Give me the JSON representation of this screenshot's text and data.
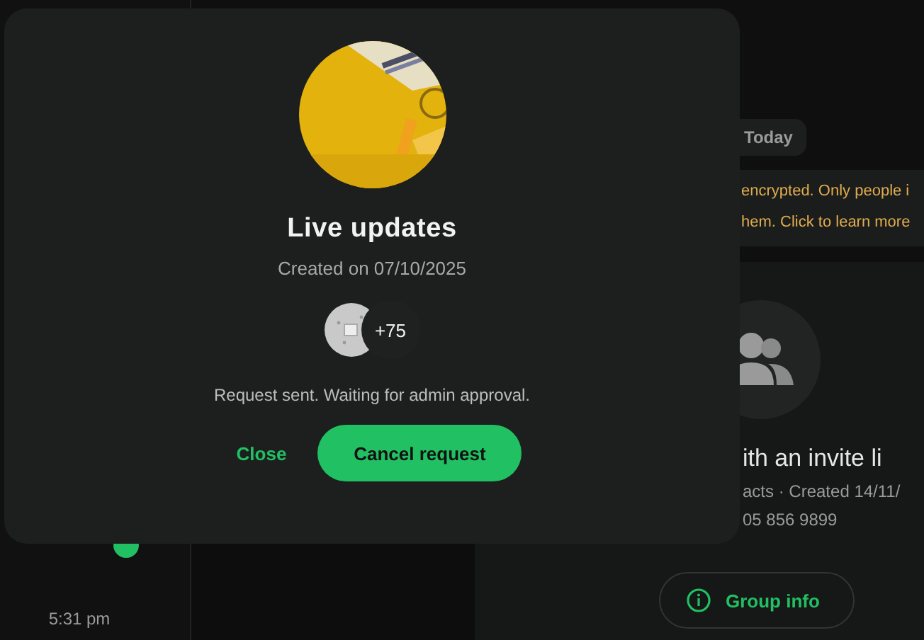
{
  "sidebar": {
    "time": "5:31 pm"
  },
  "chat": {
    "date_chip": "Today",
    "notice_lines": [
      "encrypted. Only people i",
      "hem. Click to learn more"
    ]
  },
  "group_panel": {
    "title": "ith an invite li",
    "meta": "acts · Created 14/11/",
    "phone": "05 856 9899",
    "button": "Group info"
  },
  "dialog": {
    "title": "Live updates",
    "subtitle": "Created on 07/10/2025",
    "members": {
      "more_count": "+75"
    },
    "status": "Request sent. Waiting for admin approval.",
    "buttons": [
      {
        "label": "Close",
        "kind": "text"
      },
      {
        "label": "Cancel request",
        "kind": "primary"
      }
    ]
  }
}
